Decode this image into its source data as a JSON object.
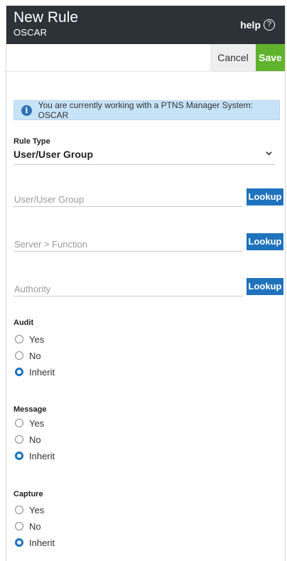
{
  "header": {
    "title": "New Rule",
    "subtitle": "OSCAR",
    "help_label": "help",
    "help_icon": "question-circle-icon",
    "help_icon_glyph": "?"
  },
  "toolbar": {
    "cancel_label": "Cancel",
    "save_label": "Save"
  },
  "info": {
    "icon": "info-icon",
    "icon_glyph": "i",
    "message": "You are currently working with a PTNS Manager System: OSCAR"
  },
  "rule_type": {
    "label": "Rule Type",
    "value": "User/User Group"
  },
  "fields": {
    "user_group": {
      "placeholder": "User/User Group",
      "button": "Lookup"
    },
    "server_function": {
      "placeholder": "Server > Function",
      "button": "Lookup"
    },
    "authority": {
      "placeholder": "Authority",
      "button": "Lookup"
    }
  },
  "audit": {
    "label": "Audit",
    "options": [
      "Yes",
      "No",
      "Inherit"
    ],
    "selected": "Inherit"
  },
  "message": {
    "label": "Message",
    "options": [
      "Yes",
      "No",
      "Inherit"
    ],
    "selected": "Inherit"
  },
  "capture": {
    "label": "Capture",
    "options": [
      "Yes",
      "No",
      "Inherit"
    ],
    "selected": "Inherit"
  },
  "colors": {
    "header_bg": "#2d3239",
    "save_green": "#61b32d",
    "primary_blue": "#1f73bd",
    "info_bg": "#c7e3f8"
  }
}
